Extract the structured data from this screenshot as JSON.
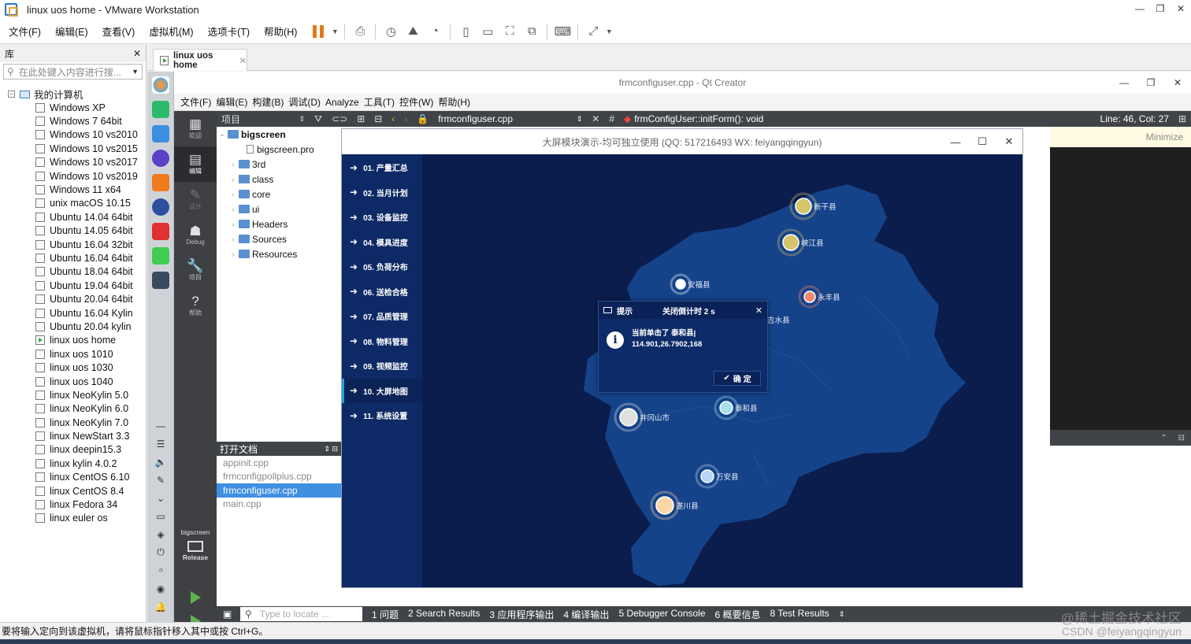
{
  "vmware": {
    "title": "linux uos home - VMware Workstation",
    "menu": [
      "文件(F)",
      "编辑(E)",
      "查看(V)",
      "虚拟机(M)",
      "选项卡(T)",
      "帮助(H)"
    ],
    "status": "要将输入定向到该虚拟机，请将鼠标指针移入其中或按 Ctrl+G。"
  },
  "library": {
    "title": "库",
    "search_placeholder": "在此处键入内容进行搜...",
    "root": "我的计算机",
    "vms": [
      "Windows XP",
      "Windows 7 64bit",
      "Windows 10 vs2010",
      "Windows 10 vs2015",
      "Windows 10 vs2017",
      "Windows 10 vs2019",
      "Windows 11 x64",
      "unix macOS 10.15",
      "Ubuntu 14.04 64bit",
      "Ubuntu 14.05 64bit",
      "Ubuntu 16.04 32bit",
      "Ubuntu 16.04 64bit",
      "Ubuntu 18.04 64bit",
      "Ubuntu 19.04 64bit",
      "Ubuntu 20.04 64bit",
      "Ubuntu 16.04 Kylin",
      "Ubuntu 20.04 kylin",
      "linux uos home",
      "linux uos 1010",
      "linux uos 1030",
      "linux uos 1040",
      "linux NeoKylin 5.0",
      "linux NeoKylin 6.0",
      "linux NeoKylin 7.0",
      "linux NewStart 3.3",
      "linux deepin15.3",
      "linux kylin 4.0.2",
      "linux CentOS 6.10",
      "linux CentOS 8.4",
      "linux Fedora 34",
      "linux euler os"
    ]
  },
  "vm_tab": {
    "label": "linux uos home"
  },
  "qt": {
    "title": "frmconfiguser.cpp - Qt Creator",
    "menu": [
      "文件(F)",
      "编辑(E)",
      "构建(B)",
      "调试(D)",
      "Analyze",
      "工具(T)",
      "控件(W)",
      "帮助(H)"
    ],
    "modes": [
      "欢迎",
      "编辑",
      "设计",
      "Debug",
      "项目",
      "帮助"
    ],
    "kit_project": "bigscreen",
    "kit_config": "Release",
    "toolbar": {
      "project_label": "项目",
      "file": "frmconfiguser.cpp",
      "hash": "#",
      "symbol": "frmConfigUser::initForm(): void",
      "position": "Line: 46, Col: 27"
    },
    "tree": {
      "root": "bigscreen",
      "pro": "bigscreen.pro",
      "folders": [
        "3rd",
        "class",
        "core",
        "ui",
        "Headers",
        "Sources",
        "Resources"
      ]
    },
    "open_docs": {
      "title": "打开文档",
      "files": [
        "appinit.cpp",
        "frmconfigpollplus.cpp",
        "frmconfiguser.cpp",
        "main.cpp"
      ],
      "selected": 2
    },
    "minimize": "Minimize",
    "locate_placeholder": "Type to locate ...",
    "output_panes": [
      "1 问题",
      "2 Search Results",
      "3 应用程序输出",
      "4 编译输出",
      "5 Debugger Console",
      "6 概要信息",
      "8 Test Results"
    ]
  },
  "app": {
    "title": "大屏模块演示-均可独立使用 (QQ: 517216493 WX: feiyangqingyun)",
    "nav": [
      "01. 产量汇总",
      "02. 当月计划",
      "03. 设备监控",
      "04. 模具进度",
      "05. 负荷分布",
      "06. 送检合格",
      "07. 品质管理",
      "08. 物料管理",
      "09. 视频监控",
      "10. 大屏地图",
      "11. 系统设置"
    ],
    "active_nav": 9,
    "cities": [
      {
        "name": "新干县",
        "color": "#d4c46a"
      },
      {
        "name": "峡江县",
        "color": "#d4c46a"
      },
      {
        "name": "安福县",
        "color": "#ffffff"
      },
      {
        "name": "永丰县",
        "color": "#f08a6e"
      },
      {
        "name": "吉水县",
        "color": "#f08a6e"
      },
      {
        "name": "井冈山市",
        "color": "#e0e0e0"
      },
      {
        "name": "泰和县",
        "color": "#a8e0f0"
      },
      {
        "name": "万安县",
        "color": "#b9d4f5"
      },
      {
        "name": "遂川县",
        "color": "#fbd7a8"
      }
    ],
    "dialog": {
      "title": "提示",
      "countdown": "关闭倒计时 2 s",
      "line1": "当前单击了 泰和县|",
      "line2": "114.901,26.7902,168",
      "ok": "确 定"
    }
  },
  "watermark": {
    "line1": "@稀土掘金技术社区",
    "line2": "CSDN @feiyangqingyun"
  }
}
